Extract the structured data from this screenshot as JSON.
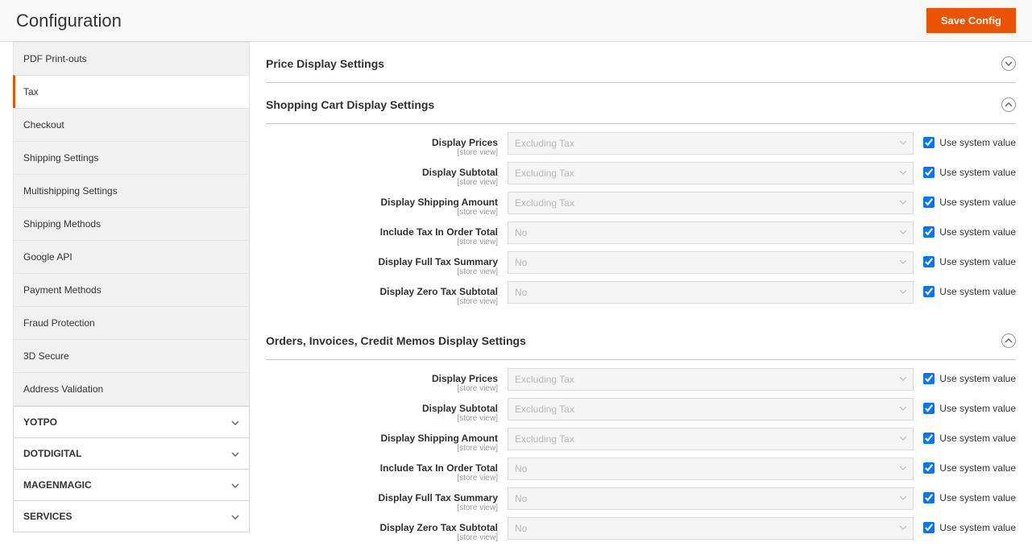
{
  "header": {
    "title": "Configuration",
    "save_button": "Save Config"
  },
  "sidebar": {
    "items": [
      {
        "label": "PDF Print-outs",
        "active": false
      },
      {
        "label": "Tax",
        "active": true
      },
      {
        "label": "Checkout",
        "active": false
      },
      {
        "label": "Shipping Settings",
        "active": false
      },
      {
        "label": "Multishipping Settings",
        "active": false
      },
      {
        "label": "Shipping Methods",
        "active": false
      },
      {
        "label": "Google API",
        "active": false
      },
      {
        "label": "Payment Methods",
        "active": false
      },
      {
        "label": "Fraud Protection",
        "active": false
      },
      {
        "label": "3D Secure",
        "active": false
      },
      {
        "label": "Address Validation",
        "active": false
      }
    ],
    "sections": [
      {
        "label": "YOTPO"
      },
      {
        "label": "DOTDIGITAL"
      },
      {
        "label": "MAGENMAGIC"
      },
      {
        "label": "SERVICES"
      }
    ]
  },
  "main": {
    "sections": [
      {
        "title": "Price Display Settings",
        "expanded": false,
        "fields": []
      },
      {
        "title": "Shopping Cart Display Settings",
        "expanded": true,
        "fields": [
          {
            "label": "Display Prices",
            "scope": "[store view]",
            "value": "Excluding Tax",
            "use_system": true,
            "use_system_label": "Use system value"
          },
          {
            "label": "Display Subtotal",
            "scope": "[store view]",
            "value": "Excluding Tax",
            "use_system": true,
            "use_system_label": "Use system value"
          },
          {
            "label": "Display Shipping Amount",
            "scope": "[store view]",
            "value": "Excluding Tax",
            "use_system": true,
            "use_system_label": "Use system value"
          },
          {
            "label": "Include Tax In Order Total",
            "scope": "[store view]",
            "value": "No",
            "use_system": true,
            "use_system_label": "Use system value"
          },
          {
            "label": "Display Full Tax Summary",
            "scope": "[store view]",
            "value": "No",
            "use_system": true,
            "use_system_label": "Use system value"
          },
          {
            "label": "Display Zero Tax Subtotal",
            "scope": "[store view]",
            "value": "No",
            "use_system": true,
            "use_system_label": "Use system value"
          }
        ]
      },
      {
        "title": "Orders, Invoices, Credit Memos Display Settings",
        "expanded": true,
        "fields": [
          {
            "label": "Display Prices",
            "scope": "[store view]",
            "value": "Excluding Tax",
            "use_system": true,
            "use_system_label": "Use system value"
          },
          {
            "label": "Display Subtotal",
            "scope": "[store view]",
            "value": "Excluding Tax",
            "use_system": true,
            "use_system_label": "Use system value"
          },
          {
            "label": "Display Shipping Amount",
            "scope": "[store view]",
            "value": "Excluding Tax",
            "use_system": true,
            "use_system_label": "Use system value"
          },
          {
            "label": "Include Tax In Order Total",
            "scope": "[store view]",
            "value": "No",
            "use_system": true,
            "use_system_label": "Use system value"
          },
          {
            "label": "Display Full Tax Summary",
            "scope": "[store view]",
            "value": "No",
            "use_system": true,
            "use_system_label": "Use system value"
          },
          {
            "label": "Display Zero Tax Subtotal",
            "scope": "[store view]",
            "value": "No",
            "use_system": true,
            "use_system_label": "Use system value"
          }
        ]
      }
    ]
  }
}
